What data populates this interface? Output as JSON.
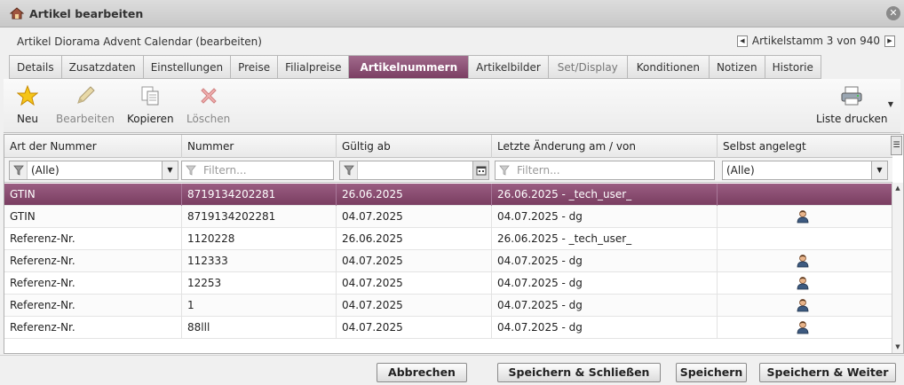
{
  "window": {
    "title": "Artikel bearbeiten",
    "close_icon": "close-icon"
  },
  "header": {
    "doc_title": "Artikel Diorama Advent Calendar (bearbeiten)",
    "pager_text": "Artikelstamm 3 von 940"
  },
  "tabs": [
    {
      "label": "Details"
    },
    {
      "label": "Zusatzdaten"
    },
    {
      "label": "Einstellungen"
    },
    {
      "label": "Preise"
    },
    {
      "label": "Filialpreise"
    },
    {
      "label": "Artikelnummern"
    },
    {
      "label": "Artikelbilder"
    },
    {
      "label": "Set/Display"
    },
    {
      "label": "Konditionen"
    },
    {
      "label": "Notizen"
    },
    {
      "label": "Historie"
    }
  ],
  "active_tab": "Artikelnummern",
  "toolbar": {
    "new_label": "Neu",
    "edit_label": "Bearbeiten",
    "copy_label": "Kopieren",
    "delete_label": "Löschen",
    "print_label": "Liste drucken"
  },
  "grid": {
    "columns": [
      "Art der Nummer",
      "Nummer",
      "Gültig ab",
      "Letzte Änderung am / von",
      "Selbst angelegt"
    ],
    "filters": {
      "type_value": "(Alle)",
      "number_placeholder": "Filtern...",
      "date_value": "",
      "changed_placeholder": "Filtern...",
      "self_value": "(Alle)"
    },
    "rows": [
      {
        "type": "GTIN",
        "number": "8719134202281",
        "valid_from": "26.06.2025",
        "changed": "26.06.2025 - _tech_user_",
        "self": false
      },
      {
        "type": "GTIN",
        "number": "8719134202281",
        "valid_from": "04.07.2025",
        "changed": "04.07.2025 - dg",
        "self": true
      },
      {
        "type": "Referenz-Nr.",
        "number": "1120228",
        "valid_from": "26.06.2025",
        "changed": "26.06.2025 - _tech_user_",
        "self": false
      },
      {
        "type": "Referenz-Nr.",
        "number": "112333",
        "valid_from": "04.07.2025",
        "changed": "04.07.2025 - dg",
        "self": true
      },
      {
        "type": "Referenz-Nr.",
        "number": "12253",
        "valid_from": "04.07.2025",
        "changed": "04.07.2025 - dg",
        "self": true
      },
      {
        "type": "Referenz-Nr.",
        "number": "1",
        "valid_from": "04.07.2025",
        "changed": "04.07.2025 - dg",
        "self": true
      },
      {
        "type": "Referenz-Nr.",
        "number": "88lll",
        "valid_from": "04.07.2025",
        "changed": "04.07.2025 - dg",
        "self": true
      }
    ]
  },
  "footer": {
    "cancel_label": "Abbrechen",
    "save_close_label": "Speichern & Schließen",
    "save_label": "Speichern",
    "save_next_label": "Speichern & Weiter"
  },
  "colors": {
    "accent": "#7b3f63",
    "selected_row": "#8a4e72"
  }
}
